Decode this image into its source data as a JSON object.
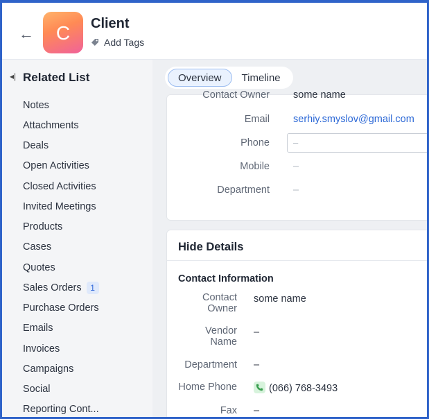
{
  "header": {
    "back_label": "←",
    "avatar_letter": "C",
    "record_name": "Client",
    "add_tags_label": "Add Tags"
  },
  "sidebar": {
    "title": "Related List",
    "items": [
      {
        "label": "Notes"
      },
      {
        "label": "Attachments"
      },
      {
        "label": "Deals"
      },
      {
        "label": "Open Activities"
      },
      {
        "label": "Closed Activities"
      },
      {
        "label": "Invited Meetings"
      },
      {
        "label": "Products"
      },
      {
        "label": "Cases"
      },
      {
        "label": "Quotes"
      },
      {
        "label": "Sales Orders",
        "badge": "1"
      },
      {
        "label": "Purchase Orders"
      },
      {
        "label": "Emails"
      },
      {
        "label": "Invoices"
      },
      {
        "label": "Campaigns"
      },
      {
        "label": "Social"
      },
      {
        "label": "Reporting Cont..."
      }
    ]
  },
  "tabs": [
    {
      "label": "Overview",
      "active": true
    },
    {
      "label": "Timeline",
      "active": false
    }
  ],
  "overview": {
    "contact_owner_label": "Contact Owner",
    "contact_owner_value": "some name",
    "email_label": "Email",
    "email_value": "serhiy.smyslov@gmail.com",
    "phone_label": "Phone",
    "phone_placeholder": "–",
    "mobile_label": "Mobile",
    "mobile_value": "–",
    "department_label": "Department",
    "department_value": "–"
  },
  "details": {
    "hide_details_label": "Hide Details",
    "section_title": "Contact Information",
    "contact_owner_label_1": "Contact",
    "contact_owner_label_2": "Owner",
    "contact_owner_value": "some name",
    "vendor_name_label_1": "Vendor",
    "vendor_name_label_2": "Name",
    "vendor_name_value": "–",
    "department_label": "Department",
    "department_value": "–",
    "home_phone_label": "Home Phone",
    "home_phone_value": "(066) 768-3493",
    "fax_label": "Fax",
    "fax_value": "–"
  },
  "colors": {
    "frame_border": "#2f63c9",
    "link": "#2a67d6",
    "sidebar_bg": "#f4f5f7",
    "main_bg": "#eef0f3"
  },
  "icons": {
    "back": "arrow-left-icon",
    "tag": "tag-icon",
    "collapse": "collapse-sidebar-icon",
    "phone": "phone-icon"
  }
}
